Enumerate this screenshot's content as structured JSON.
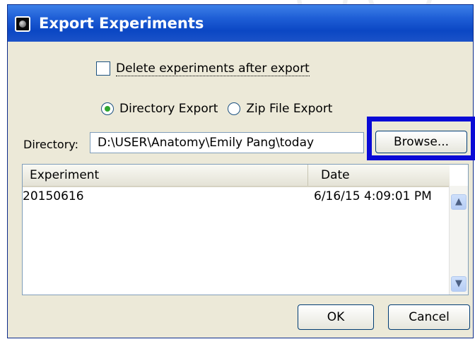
{
  "dialog": {
    "title": "Export Experiments"
  },
  "options": {
    "delete_after_export_label": "Delete experiments after export",
    "delete_after_export_checked": false,
    "directory_export_label": "Directory Export",
    "zip_export_label": "Zip File Export",
    "selected_mode": "Directory Export"
  },
  "directory": {
    "label": "Directory:",
    "value": "D:\\USER\\Anatomy\\Emily Pang\\today",
    "browse_label": "Browse..."
  },
  "table": {
    "columns": [
      "Experiment",
      "Date"
    ],
    "rows": [
      {
        "experiment": "20150616",
        "date": "6/16/15 4:09:01 PM"
      }
    ]
  },
  "footer": {
    "ok_label": "OK",
    "cancel_label": "Cancel"
  },
  "colors": {
    "title_bar": "#0b47c4",
    "highlight_box": "#0a0ad6",
    "dialog_bg": "#ece9d8",
    "radio_selected": "#2fa52f"
  },
  "icons": {
    "window_icon": "app-window-icon",
    "scroll_up": "chevron-up-icon",
    "scroll_down": "chevron-down-icon"
  }
}
